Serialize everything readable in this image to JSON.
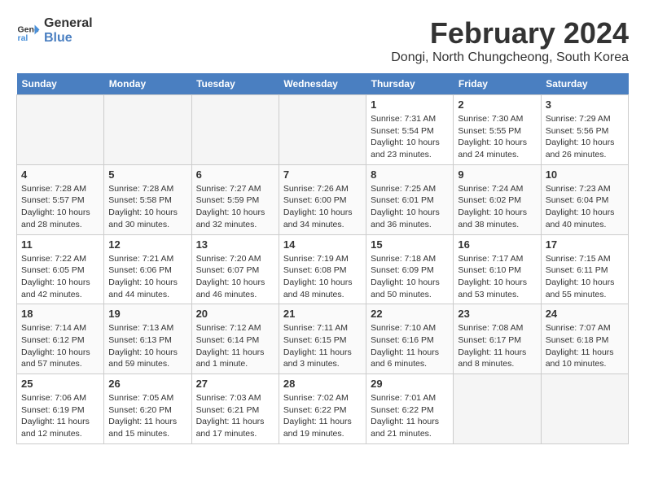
{
  "logo": {
    "line1": "General",
    "line2": "Blue"
  },
  "title": "February 2024",
  "subtitle": "Dongi, North Chungcheong, South Korea",
  "headers": [
    "Sunday",
    "Monday",
    "Tuesday",
    "Wednesday",
    "Thursday",
    "Friday",
    "Saturday"
  ],
  "weeks": [
    [
      {
        "num": "",
        "info": ""
      },
      {
        "num": "",
        "info": ""
      },
      {
        "num": "",
        "info": ""
      },
      {
        "num": "",
        "info": ""
      },
      {
        "num": "1",
        "info": "Sunrise: 7:31 AM\nSunset: 5:54 PM\nDaylight: 10 hours\nand 23 minutes."
      },
      {
        "num": "2",
        "info": "Sunrise: 7:30 AM\nSunset: 5:55 PM\nDaylight: 10 hours\nand 24 minutes."
      },
      {
        "num": "3",
        "info": "Sunrise: 7:29 AM\nSunset: 5:56 PM\nDaylight: 10 hours\nand 26 minutes."
      }
    ],
    [
      {
        "num": "4",
        "info": "Sunrise: 7:28 AM\nSunset: 5:57 PM\nDaylight: 10 hours\nand 28 minutes."
      },
      {
        "num": "5",
        "info": "Sunrise: 7:28 AM\nSunset: 5:58 PM\nDaylight: 10 hours\nand 30 minutes."
      },
      {
        "num": "6",
        "info": "Sunrise: 7:27 AM\nSunset: 5:59 PM\nDaylight: 10 hours\nand 32 minutes."
      },
      {
        "num": "7",
        "info": "Sunrise: 7:26 AM\nSunset: 6:00 PM\nDaylight: 10 hours\nand 34 minutes."
      },
      {
        "num": "8",
        "info": "Sunrise: 7:25 AM\nSunset: 6:01 PM\nDaylight: 10 hours\nand 36 minutes."
      },
      {
        "num": "9",
        "info": "Sunrise: 7:24 AM\nSunset: 6:02 PM\nDaylight: 10 hours\nand 38 minutes."
      },
      {
        "num": "10",
        "info": "Sunrise: 7:23 AM\nSunset: 6:04 PM\nDaylight: 10 hours\nand 40 minutes."
      }
    ],
    [
      {
        "num": "11",
        "info": "Sunrise: 7:22 AM\nSunset: 6:05 PM\nDaylight: 10 hours\nand 42 minutes."
      },
      {
        "num": "12",
        "info": "Sunrise: 7:21 AM\nSunset: 6:06 PM\nDaylight: 10 hours\nand 44 minutes."
      },
      {
        "num": "13",
        "info": "Sunrise: 7:20 AM\nSunset: 6:07 PM\nDaylight: 10 hours\nand 46 minutes."
      },
      {
        "num": "14",
        "info": "Sunrise: 7:19 AM\nSunset: 6:08 PM\nDaylight: 10 hours\nand 48 minutes."
      },
      {
        "num": "15",
        "info": "Sunrise: 7:18 AM\nSunset: 6:09 PM\nDaylight: 10 hours\nand 50 minutes."
      },
      {
        "num": "16",
        "info": "Sunrise: 7:17 AM\nSunset: 6:10 PM\nDaylight: 10 hours\nand 53 minutes."
      },
      {
        "num": "17",
        "info": "Sunrise: 7:15 AM\nSunset: 6:11 PM\nDaylight: 10 hours\nand 55 minutes."
      }
    ],
    [
      {
        "num": "18",
        "info": "Sunrise: 7:14 AM\nSunset: 6:12 PM\nDaylight: 10 hours\nand 57 minutes."
      },
      {
        "num": "19",
        "info": "Sunrise: 7:13 AM\nSunset: 6:13 PM\nDaylight: 10 hours\nand 59 minutes."
      },
      {
        "num": "20",
        "info": "Sunrise: 7:12 AM\nSunset: 6:14 PM\nDaylight: 11 hours\nand 1 minute."
      },
      {
        "num": "21",
        "info": "Sunrise: 7:11 AM\nSunset: 6:15 PM\nDaylight: 11 hours\nand 3 minutes."
      },
      {
        "num": "22",
        "info": "Sunrise: 7:10 AM\nSunset: 6:16 PM\nDaylight: 11 hours\nand 6 minutes."
      },
      {
        "num": "23",
        "info": "Sunrise: 7:08 AM\nSunset: 6:17 PM\nDaylight: 11 hours\nand 8 minutes."
      },
      {
        "num": "24",
        "info": "Sunrise: 7:07 AM\nSunset: 6:18 PM\nDaylight: 11 hours\nand 10 minutes."
      }
    ],
    [
      {
        "num": "25",
        "info": "Sunrise: 7:06 AM\nSunset: 6:19 PM\nDaylight: 11 hours\nand 12 minutes."
      },
      {
        "num": "26",
        "info": "Sunrise: 7:05 AM\nSunset: 6:20 PM\nDaylight: 11 hours\nand 15 minutes."
      },
      {
        "num": "27",
        "info": "Sunrise: 7:03 AM\nSunset: 6:21 PM\nDaylight: 11 hours\nand 17 minutes."
      },
      {
        "num": "28",
        "info": "Sunrise: 7:02 AM\nSunset: 6:22 PM\nDaylight: 11 hours\nand 19 minutes."
      },
      {
        "num": "29",
        "info": "Sunrise: 7:01 AM\nSunset: 6:22 PM\nDaylight: 11 hours\nand 21 minutes."
      },
      {
        "num": "",
        "info": ""
      },
      {
        "num": "",
        "info": ""
      }
    ]
  ]
}
